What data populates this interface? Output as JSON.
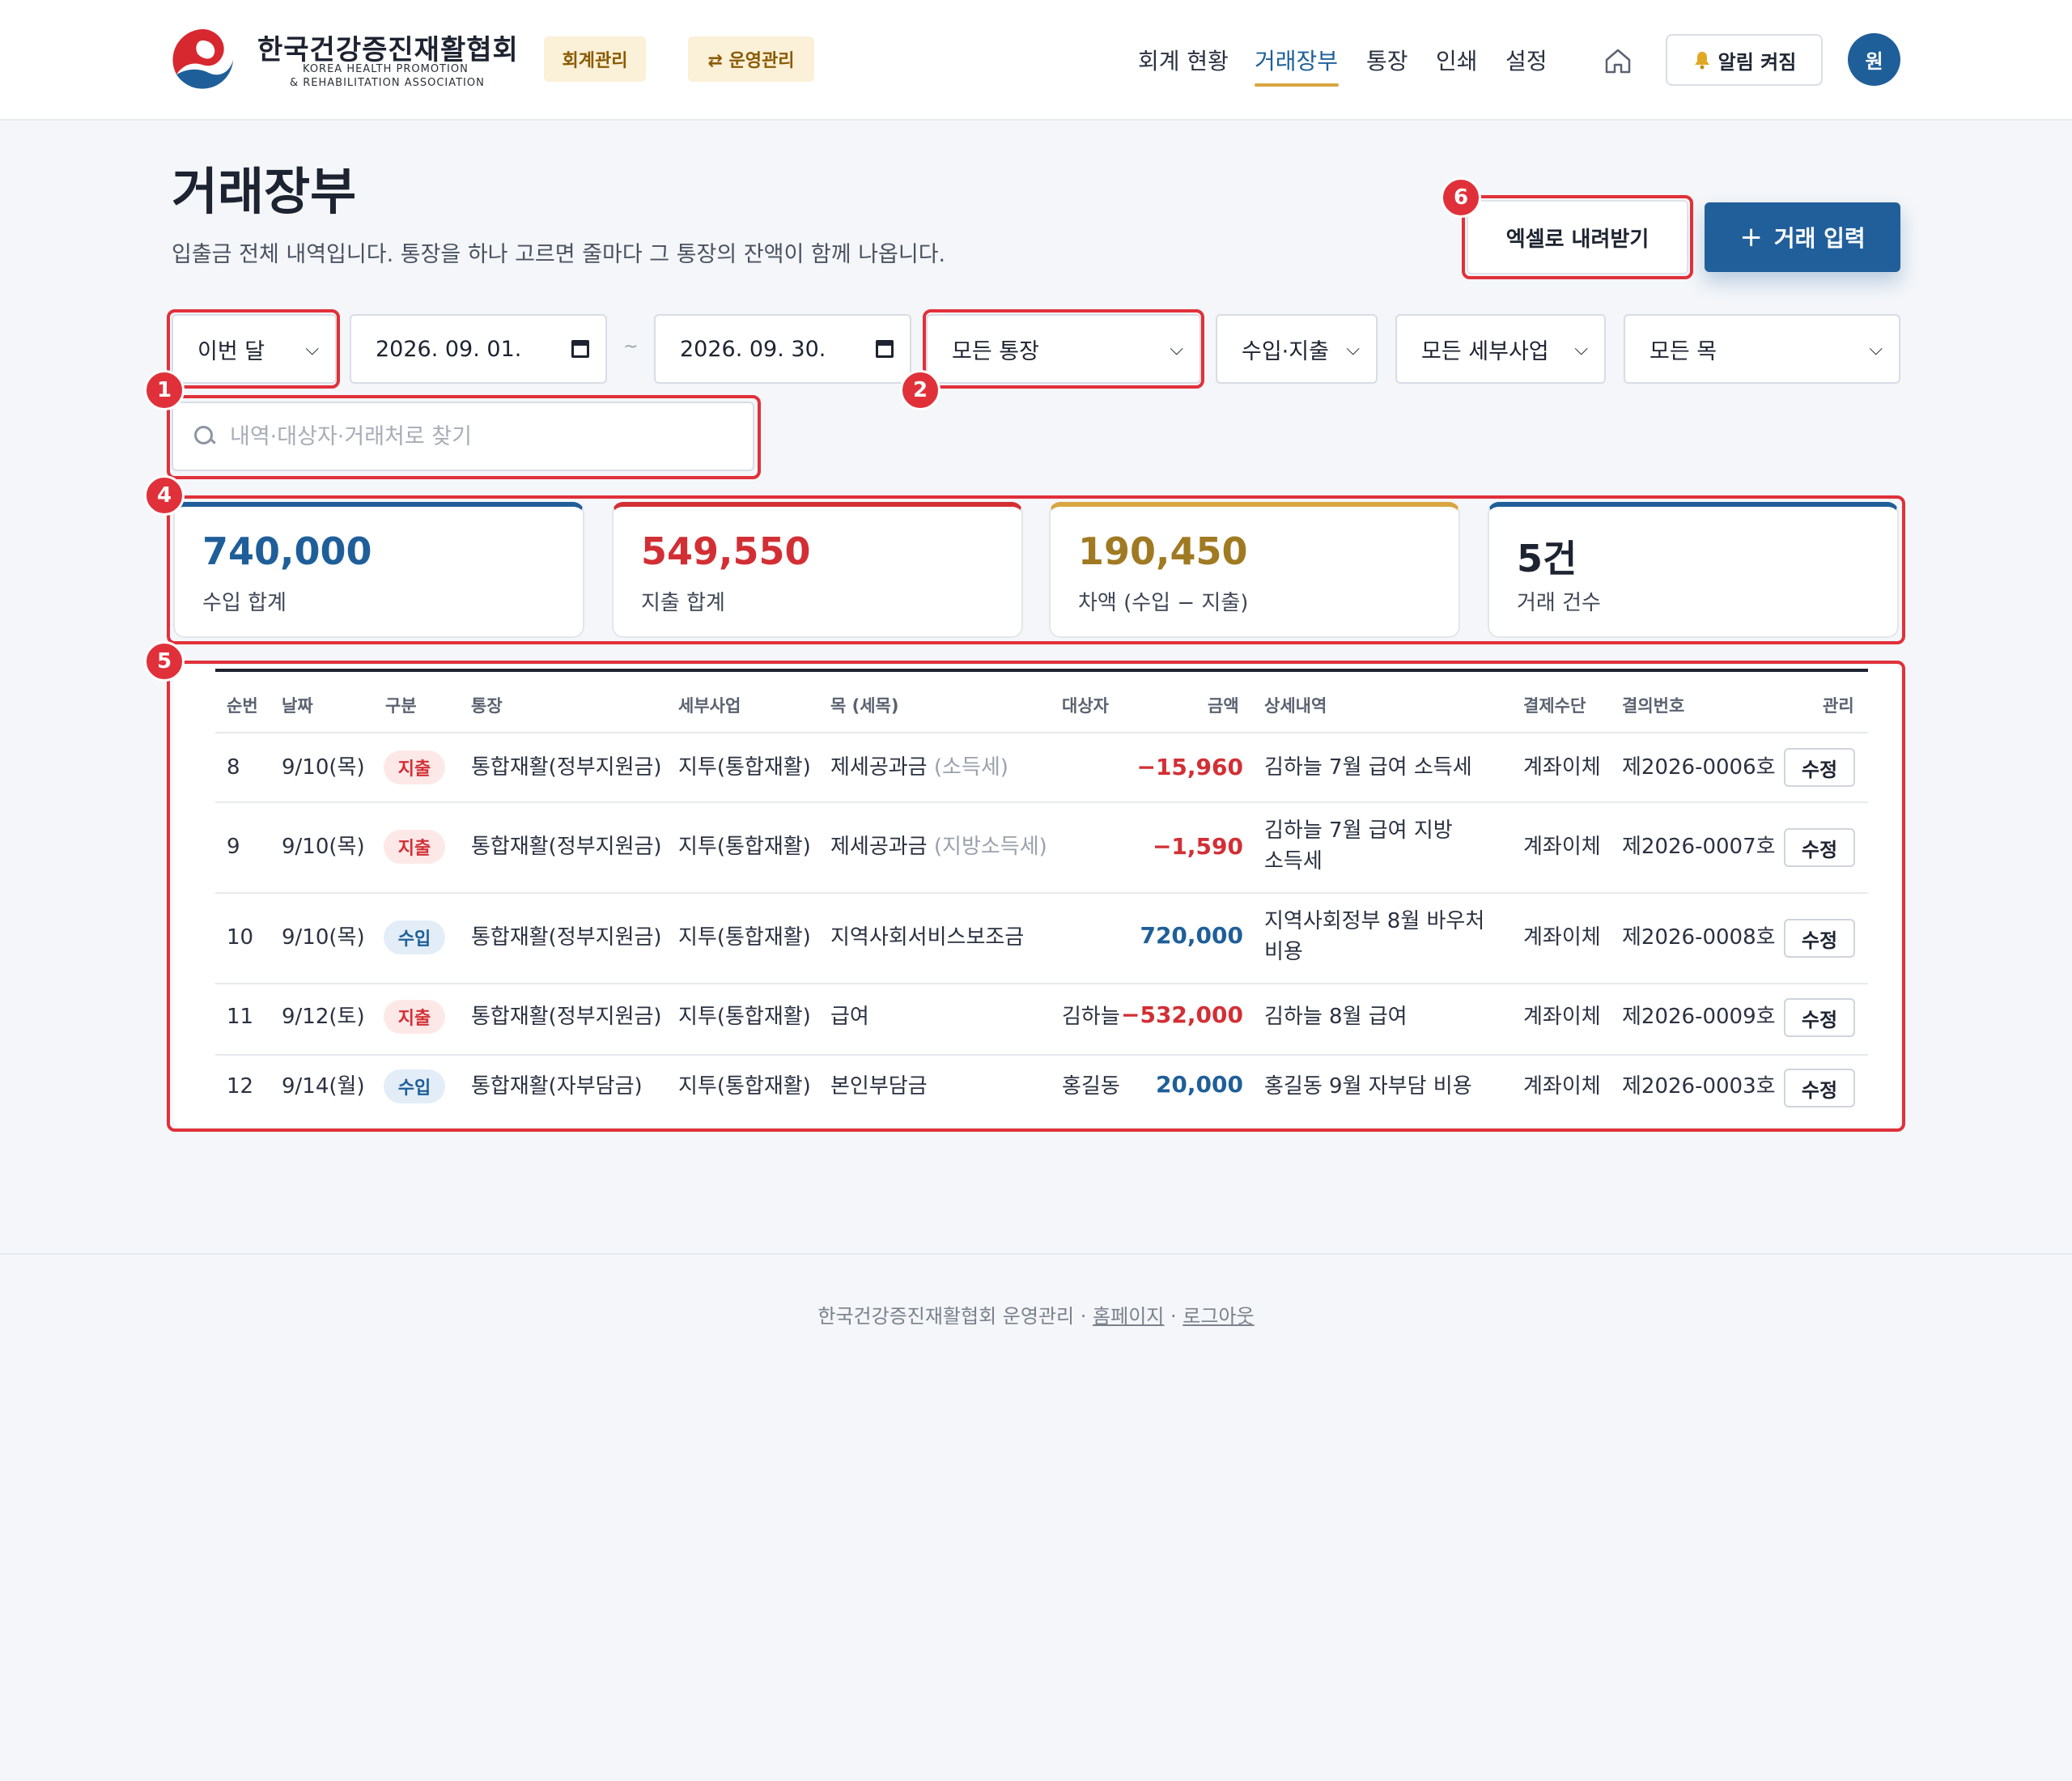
{
  "header": {
    "brand_ko": "한국건강증진재활협회",
    "brand_en_line1": "KOREA HEALTH PROMOTION",
    "brand_en_line2": "& REHABILITATION ASSOCIATION",
    "mode_pill_1": "회계관리",
    "mode_pill_2": "⇄ 운영관리",
    "nav": [
      "회계 현황",
      "거래장부",
      "통장",
      "인쇄",
      "설정"
    ],
    "active_nav": "거래장부",
    "alert_label": "알림 켜짐",
    "avatar_label": "원"
  },
  "page": {
    "title": "거래장부",
    "description": "입출금 전체 내역입니다. 통장을 하나 고르면 줄마다 그 통장의 잔액이 함께 나옵니다.",
    "excel_button": "엑셀로 내려받기",
    "add_button": "거래 입력"
  },
  "filters": {
    "period": "이번 달",
    "date_from": "2026. 09. 01.",
    "date_sep": "~",
    "date_to": "2026. 09. 30.",
    "account": "모든 통장",
    "type": "수입·지출",
    "subproject": "모든 세부사업",
    "item": "모든 목",
    "search_placeholder": "내역·대상자·거래처로 찾기",
    "search_value": ""
  },
  "summary": [
    {
      "value": "740,000",
      "label": "수입 합계",
      "color": "#1f5f99"
    },
    {
      "value": "549,550",
      "label": "지출 합계",
      "color": "#d22f35"
    },
    {
      "value": "190,450",
      "label": "차액 (수입 − 지출)",
      "color": "#a07a22"
    },
    {
      "value": "5건",
      "label": "거래 건수",
      "color": "#1d2330"
    }
  ],
  "table": {
    "headers": [
      "순번",
      "날짜",
      "구분",
      "통장",
      "세부사업",
      "목 (세목)",
      "대상자",
      "금액",
      "상세내역",
      "결제수단",
      "결의번호",
      "관리"
    ],
    "rows": [
      {
        "no": "8",
        "date": "9/10(목)",
        "kind": "지출",
        "account": "통합재활(정부지원금)",
        "sub": "지투(통합재활)",
        "item": "제세공과금",
        "item_sub": "(소득세)",
        "target": "",
        "amount": "−15,960",
        "detail1": "김하늘 7월 급여 소득세",
        "detail2": "",
        "method": "계좌이체",
        "voucher": "제2026-0006호",
        "action": "수정"
      },
      {
        "no": "9",
        "date": "9/10(목)",
        "kind": "지출",
        "account": "통합재활(정부지원금)",
        "sub": "지투(통합재활)",
        "item": "제세공과금",
        "item_sub": "(지방소득세)",
        "target": "",
        "amount": "−1,590",
        "detail1": "김하늘 7월 급여 지방",
        "detail2": "소득세",
        "method": "계좌이체",
        "voucher": "제2026-0007호",
        "action": "수정"
      },
      {
        "no": "10",
        "date": "9/10(목)",
        "kind": "수입",
        "account": "통합재활(정부지원금)",
        "sub": "지투(통합재활)",
        "item": "지역사회서비스보조금",
        "item_sub": "",
        "target": "",
        "amount": "720,000",
        "detail1": "지역사회정부 8월 바우처",
        "detail2": "비용",
        "method": "계좌이체",
        "voucher": "제2026-0008호",
        "action": "수정"
      },
      {
        "no": "11",
        "date": "9/12(토)",
        "kind": "지출",
        "account": "통합재활(정부지원금)",
        "sub": "지투(통합재활)",
        "item": "급여",
        "item_sub": "",
        "target": "김하늘",
        "amount": "−532,000",
        "detail1": "김하늘 8월 급여",
        "detail2": "",
        "method": "계좌이체",
        "voucher": "제2026-0009호",
        "action": "수정"
      },
      {
        "no": "12",
        "date": "9/14(월)",
        "kind": "수입",
        "account": "통합재활(자부담금)",
        "sub": "지투(통합재활)",
        "item": "본인부담금",
        "item_sub": "",
        "target": "홍길동",
        "amount": "20,000",
        "detail1": "홍길동 9월 자부담 비용",
        "detail2": "",
        "method": "계좌이체",
        "voucher": "제2026-0003호",
        "action": "수정"
      }
    ]
  },
  "markers": [
    "1",
    "2",
    "4",
    "5",
    "6"
  ],
  "footer": {
    "text": "한국건강증진재활협회 운영관리 ·",
    "link1": "홈페이지",
    "sep": "·",
    "link2": "로그아웃"
  },
  "colors": {
    "brand_blue": "#1f5f99",
    "expense_red": "#d22f35",
    "diff_gold": "#a07a22",
    "highlight_red": "#e0313a"
  }
}
